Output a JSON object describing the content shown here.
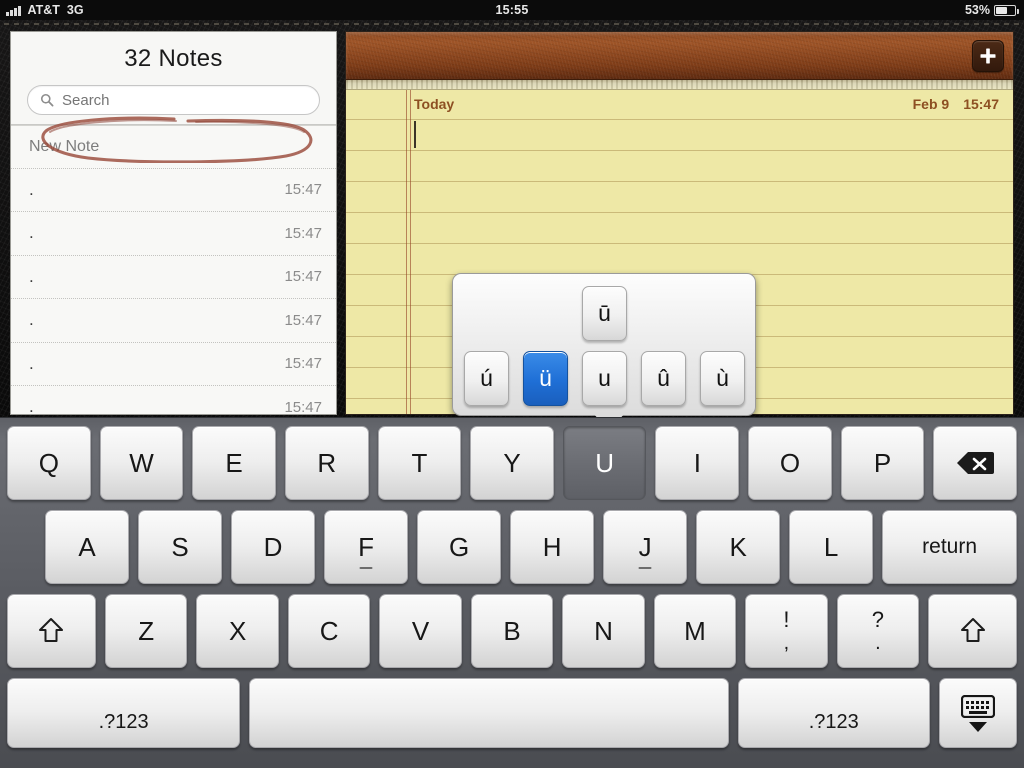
{
  "status_bar": {
    "carrier": "AT&T",
    "network": "3G",
    "signal_icon": "signal-bars-icon",
    "time": "15:55",
    "battery_percent": "53%",
    "battery_icon": "battery-icon",
    "battery_level": 53
  },
  "sidebar": {
    "title": "32 Notes",
    "search": {
      "icon": "search-icon",
      "placeholder": "Search",
      "value": ""
    },
    "rows": [
      {
        "title": "New Note",
        "time": "",
        "annotated": true
      },
      {
        "title": ".",
        "time": "15:47",
        "annotated": false
      },
      {
        "title": ".",
        "time": "15:47",
        "annotated": false
      },
      {
        "title": ".",
        "time": "15:47",
        "annotated": false
      },
      {
        "title": ".",
        "time": "15:47",
        "annotated": false
      },
      {
        "title": ".",
        "time": "15:47",
        "annotated": false
      },
      {
        "title": ".",
        "time": "15:47",
        "annotated": false
      }
    ],
    "annotation": {
      "shape": "hand-drawn-ellipse",
      "color": "#9a4a3a",
      "targets": "New Note"
    }
  },
  "note_pane": {
    "add_button_icon": "plus-icon",
    "day_label": "Today",
    "date": "Feb 9",
    "time": "15:47",
    "body_text": "",
    "cursor_visible": true,
    "paper_color": "#eee8a6",
    "rule_color": "#9a783c",
    "margin_color": "#96462 8",
    "leather_color": "#8d4a22"
  },
  "accent_popup": {
    "base_key": "U",
    "selected": "ü",
    "selected_color": "#1f6fd6",
    "top_row": [
      "ū"
    ],
    "bottom_row": [
      "ú",
      "ü",
      "u",
      "û",
      "ù"
    ]
  },
  "keyboard": {
    "row1": [
      {
        "label": "Q",
        "name": "key-q",
        "pressed": false
      },
      {
        "label": "W",
        "name": "key-w",
        "pressed": false
      },
      {
        "label": "E",
        "name": "key-e",
        "pressed": false
      },
      {
        "label": "R",
        "name": "key-r",
        "pressed": false
      },
      {
        "label": "T",
        "name": "key-t",
        "pressed": false
      },
      {
        "label": "Y",
        "name": "key-y",
        "pressed": false
      },
      {
        "label": "U",
        "name": "key-u",
        "pressed": true
      },
      {
        "label": "I",
        "name": "key-i",
        "pressed": false
      },
      {
        "label": "O",
        "name": "key-o",
        "pressed": false
      },
      {
        "label": "P",
        "name": "key-p",
        "pressed": false
      }
    ],
    "backspace_icon": "backspace-icon",
    "row2": [
      {
        "label": "A",
        "name": "key-a",
        "home": false
      },
      {
        "label": "S",
        "name": "key-s",
        "home": false
      },
      {
        "label": "D",
        "name": "key-d",
        "home": false
      },
      {
        "label": "F",
        "name": "key-f",
        "home": true
      },
      {
        "label": "G",
        "name": "key-g",
        "home": false
      },
      {
        "label": "H",
        "name": "key-h",
        "home": false
      },
      {
        "label": "J",
        "name": "key-j",
        "home": true
      },
      {
        "label": "K",
        "name": "key-k",
        "home": false
      },
      {
        "label": "L",
        "name": "key-l",
        "home": false
      }
    ],
    "return_label": "return",
    "row3": [
      {
        "label": "Z",
        "name": "key-z"
      },
      {
        "label": "X",
        "name": "key-x"
      },
      {
        "label": "C",
        "name": "key-c"
      },
      {
        "label": "V",
        "name": "key-v"
      },
      {
        "label": "B",
        "name": "key-b"
      },
      {
        "label": "N",
        "name": "key-n"
      },
      {
        "label": "M",
        "name": "key-m"
      }
    ],
    "shift_icon": "shift-arrow-icon",
    "punct1": {
      "top": "!",
      "bottom": ","
    },
    "punct2": {
      "top": "?",
      "bottom": "."
    },
    "numeric_left_label": ".?123",
    "numeric_right_label": ".?123",
    "space_label": "",
    "hide_keyboard_icon": "hide-keyboard-icon"
  }
}
